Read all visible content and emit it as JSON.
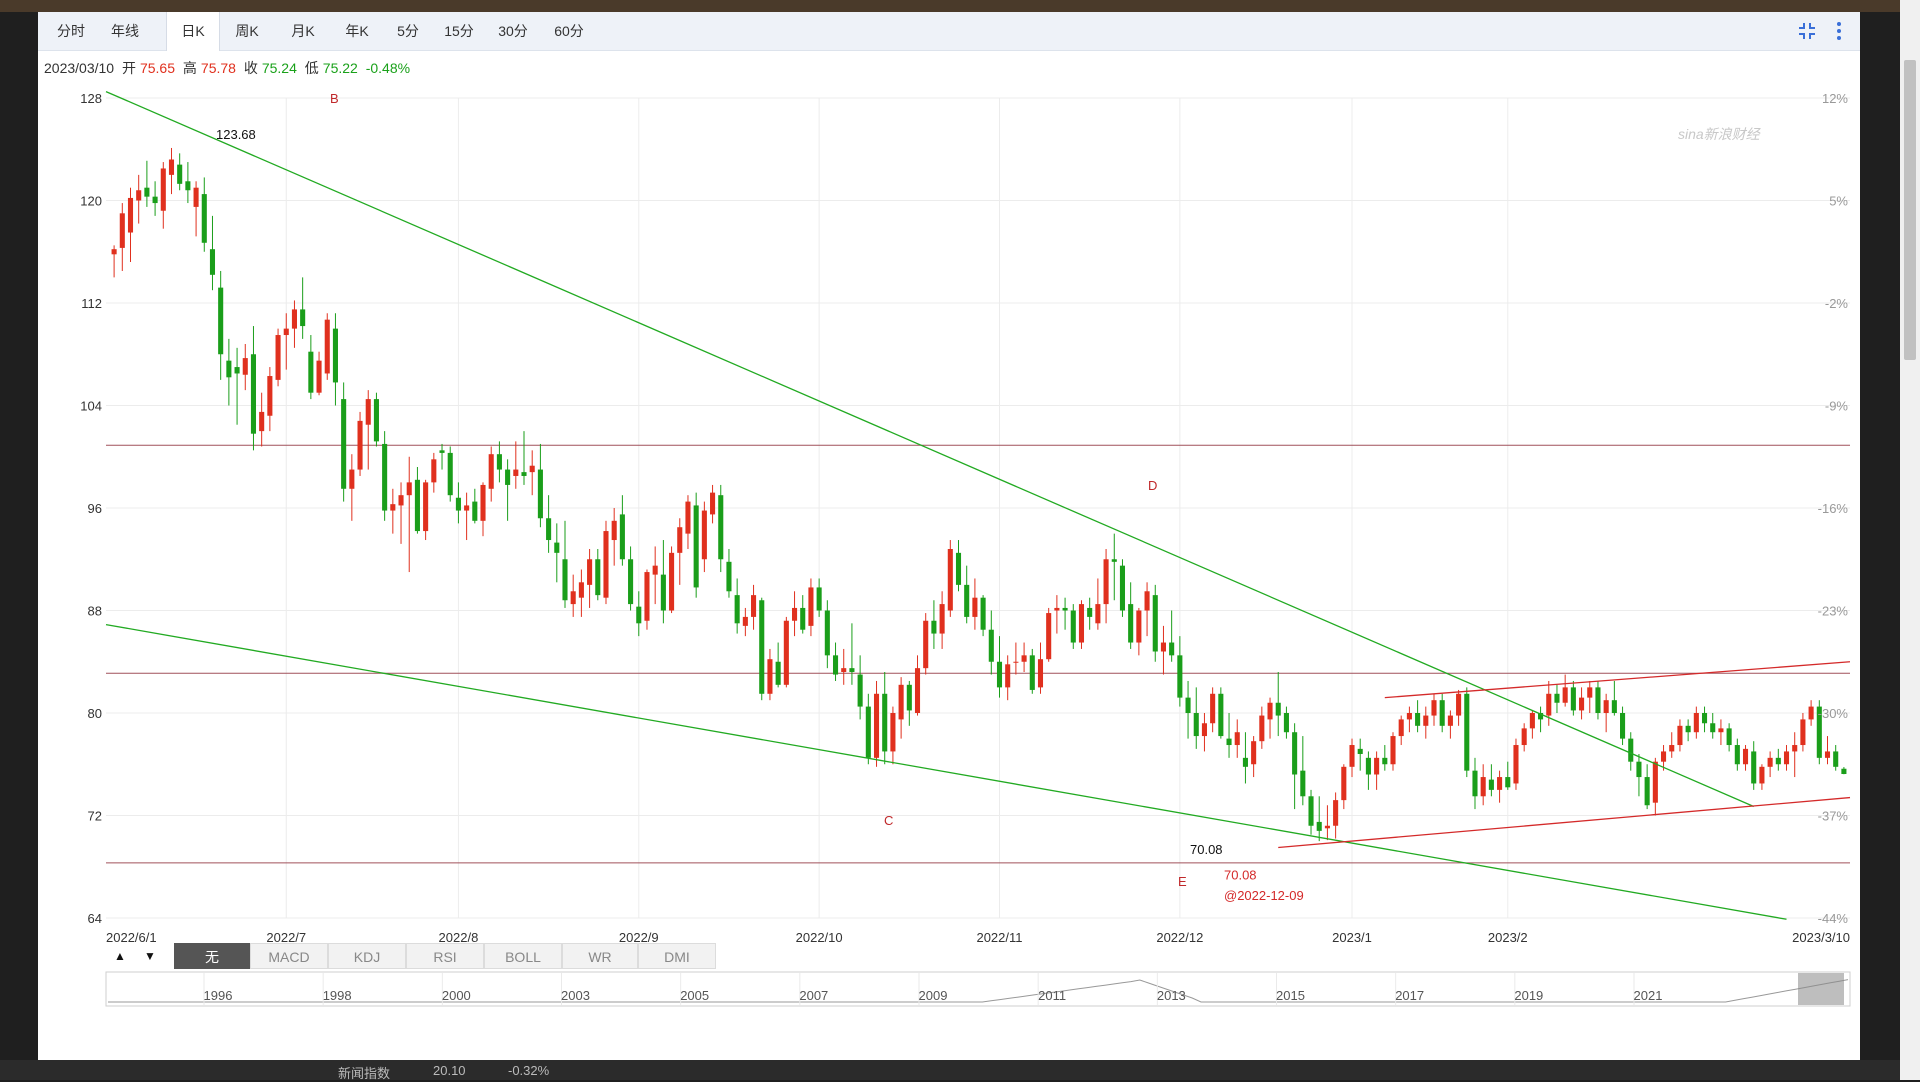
{
  "toolbar": {
    "tabs": [
      "分时",
      "年线",
      "日K",
      "周K",
      "月K",
      "年K",
      "5分",
      "15分",
      "30分",
      "60分"
    ],
    "active_tab": "日K",
    "icons": [
      "collapse-icon",
      "more-vertical-icon"
    ]
  },
  "quote": {
    "date": "2023/03/10",
    "open_label": "开",
    "open": "75.65",
    "high_label": "高",
    "high": "75.78",
    "close_label": "收",
    "close": "75.24",
    "low_label": "低",
    "low": "75.22",
    "change": "-0.48%"
  },
  "indicators": {
    "tabs": [
      "无",
      "MACD",
      "KDJ",
      "RSI",
      "BOLL",
      "WR",
      "DMI"
    ],
    "active": "无",
    "up_arrow": "▲",
    "down_arrow": "▼"
  },
  "overview": {
    "years": [
      "1996",
      "1998",
      "2000",
      "2003",
      "2005",
      "2007",
      "2009",
      "2011",
      "2013",
      "2015",
      "2017",
      "2019",
      "2021"
    ]
  },
  "background_text": {
    "bottom_items": [
      "新闻指数",
      "20.10",
      "-0.32%"
    ]
  },
  "chart_data": {
    "type": "candlestick",
    "xlabels": [
      "2022/6/1",
      "2022/7",
      "2022/8",
      "2022/9",
      "2022/10",
      "2022/11",
      "2022/12",
      "2023/1",
      "2023/2",
      "2023/3/10"
    ],
    "y_left_ticks": [
      128,
      120,
      112,
      104,
      96,
      88,
      80,
      72,
      64
    ],
    "ylim": [
      64,
      128
    ],
    "y_right_ticks": [
      "12%",
      "5%",
      "-2%",
      "-9%",
      "-16%",
      "-23%",
      "-30%",
      "-37%",
      "-44%"
    ],
    "annotations": [
      {
        "text": "B"
      },
      {
        "text": "C"
      },
      {
        "text": "D"
      },
      {
        "text": "E"
      },
      {
        "text": "123.68"
      },
      {
        "text": "70.08"
      },
      {
        "text": "70.08"
      },
      {
        "text": "@2022-12-09"
      }
    ],
    "horizontal_levels": [
      100.9,
      83.1,
      68.3
    ],
    "trendlines": [
      {
        "color": "#22aa22",
        "from": [
          "2022/6/1",
          128.5
        ],
        "to": [
          "2023/2/22",
          72.7
        ]
      },
      {
        "color": "#22aa22",
        "from": [
          "2022/6/1",
          86.9
        ],
        "to": [
          "2023/2/28",
          63.9
        ]
      },
      {
        "color": "#d42a2a",
        "from": [
          "2022/12/28",
          81.2
        ],
        "to": [
          "2023/3/10",
          84.0
        ]
      },
      {
        "color": "#d42a2a",
        "from": [
          "2022/12/14",
          69.5
        ],
        "to": [
          "2023/3/10",
          73.4
        ]
      }
    ],
    "watermark": "sina新浪财经",
    "candles": [
      [
        115.8,
        116.5,
        114.0,
        116.2
      ],
      [
        116.3,
        119.8,
        114.5,
        119.0
      ],
      [
        117.5,
        121.0,
        115.2,
        120.2
      ],
      [
        120.0,
        122.0,
        118.2,
        120.8
      ],
      [
        121.0,
        123.1,
        119.5,
        120.3
      ],
      [
        120.3,
        121.5,
        118.8,
        119.8
      ],
      [
        119.2,
        123.0,
        117.8,
        122.5
      ],
      [
        122.0,
        124.1,
        120.5,
        123.2
      ],
      [
        122.8,
        123.68,
        120.8,
        121.3
      ],
      [
        121.5,
        123.0,
        119.8,
        120.8
      ],
      [
        119.5,
        121.5,
        117.2,
        121.0
      ],
      [
        120.5,
        121.8,
        116.0,
        116.7
      ],
      [
        116.2,
        118.8,
        113.0,
        114.2
      ],
      [
        113.2,
        114.5,
        106.0,
        108.0
      ],
      [
        107.5,
        109.2,
        104.0,
        106.2
      ],
      [
        107.0,
        108.5,
        102.5,
        106.5
      ],
      [
        106.4,
        108.8,
        105.2,
        107.7
      ],
      [
        108.0,
        110.2,
        100.5,
        101.8
      ],
      [
        102.0,
        105.0,
        100.8,
        103.5
      ],
      [
        103.2,
        107.0,
        102.0,
        106.3
      ],
      [
        106.0,
        110.0,
        105.5,
        109.5
      ],
      [
        109.5,
        111.2,
        106.8,
        110.0
      ],
      [
        110.0,
        112.2,
        108.5,
        111.5
      ],
      [
        111.5,
        114.0,
        109.2,
        110.2
      ],
      [
        108.2,
        109.5,
        104.5,
        105.0
      ],
      [
        105.0,
        108.2,
        104.8,
        107.5
      ],
      [
        106.5,
        111.2,
        106.0,
        110.7
      ],
      [
        110.0,
        111.2,
        104.0,
        105.8
      ],
      [
        104.5,
        105.8,
        96.5,
        97.5
      ],
      [
        97.5,
        100.2,
        95.0,
        99.0
      ],
      [
        99.0,
        103.5,
        98.5,
        102.8
      ],
      [
        102.5,
        105.2,
        99.0,
        104.5
      ],
      [
        104.5,
        105.0,
        100.8,
        101.2
      ],
      [
        101.0,
        102.0,
        95.0,
        95.8
      ],
      [
        95.8,
        97.5,
        94.0,
        96.3
      ],
      [
        96.2,
        98.0,
        93.2,
        97.0
      ],
      [
        97.0,
        100.0,
        91.0,
        98.0
      ],
      [
        98.2,
        99.2,
        94.0,
        94.2
      ],
      [
        94.2,
        98.2,
        93.5,
        98.0
      ],
      [
        98.0,
        100.3,
        97.2,
        99.8
      ],
      [
        100.5,
        101.0,
        99.0,
        100.3
      ],
      [
        100.3,
        100.8,
        96.5,
        97.0
      ],
      [
        96.8,
        98.0,
        94.8,
        95.8
      ],
      [
        95.8,
        97.2,
        93.5,
        96.2
      ],
      [
        96.5,
        97.5,
        94.8,
        95.0
      ],
      [
        95.0,
        98.0,
        93.8,
        97.8
      ],
      [
        97.5,
        100.8,
        96.5,
        100.2
      ],
      [
        100.2,
        101.2,
        98.0,
        99.0
      ],
      [
        99.0,
        99.8,
        95.0,
        97.8
      ],
      [
        98.5,
        101.2,
        97.5,
        99.0
      ],
      [
        98.8,
        102.0,
        97.8,
        98.5
      ],
      [
        98.8,
        100.5,
        97.0,
        99.3
      ],
      [
        99.0,
        101.0,
        94.5,
        95.2
      ],
      [
        95.2,
        97.0,
        92.5,
        93.5
      ],
      [
        93.3,
        94.8,
        90.2,
        92.5
      ],
      [
        92.0,
        95.0,
        88.2,
        88.8
      ],
      [
        88.5,
        90.8,
        87.5,
        89.5
      ],
      [
        89.0,
        91.2,
        87.5,
        90.2
      ],
      [
        90.0,
        92.8,
        88.2,
        92.0
      ],
      [
        92.0,
        92.8,
        88.8,
        89.2
      ],
      [
        89.0,
        95.0,
        88.5,
        94.2
      ],
      [
        93.5,
        96.0,
        91.5,
        95.0
      ],
      [
        95.5,
        97.0,
        91.5,
        92.0
      ],
      [
        92.0,
        93.0,
        88.0,
        88.5
      ],
      [
        88.3,
        89.5,
        86.0,
        87.0
      ],
      [
        87.2,
        91.2,
        86.5,
        91.0
      ],
      [
        90.8,
        93.0,
        88.5,
        91.5
      ],
      [
        90.8,
        93.5,
        87.0,
        88.0
      ],
      [
        88.0,
        93.0,
        87.8,
        92.5
      ],
      [
        92.5,
        95.2,
        90.0,
        94.5
      ],
      [
        94.0,
        97.0,
        92.8,
        96.5
      ],
      [
        96.2,
        97.2,
        89.0,
        89.8
      ],
      [
        92.0,
        96.5,
        91.0,
        95.8
      ],
      [
        95.5,
        97.8,
        94.8,
        97.2
      ],
      [
        97.0,
        97.8,
        91.0,
        92.0
      ],
      [
        91.8,
        92.8,
        89.0,
        89.5
      ],
      [
        89.2,
        90.5,
        86.2,
        87.0
      ],
      [
        86.8,
        88.2,
        86.0,
        87.5
      ],
      [
        87.5,
        90.0,
        86.5,
        89.2
      ],
      [
        88.8,
        89.0,
        81.0,
        81.5
      ],
      [
        81.5,
        85.0,
        81.0,
        84.2
      ],
      [
        84.0,
        85.5,
        82.0,
        82.2
      ],
      [
        82.2,
        87.5,
        82.0,
        87.2
      ],
      [
        87.2,
        89.5,
        86.0,
        88.2
      ],
      [
        88.2,
        89.2,
        86.2,
        86.5
      ],
      [
        86.8,
        90.5,
        86.0,
        89.8
      ],
      [
        89.8,
        90.5,
        87.5,
        88.0
      ],
      [
        88.0,
        88.8,
        83.5,
        84.5
      ],
      [
        84.5,
        85.5,
        82.5,
        83.0
      ],
      [
        83.2,
        85.0,
        82.2,
        83.5
      ],
      [
        83.5,
        87.0,
        82.2,
        83.2
      ],
      [
        83.0,
        84.5,
        79.5,
        80.5
      ],
      [
        80.5,
        81.5,
        76.0,
        76.5
      ],
      [
        76.5,
        82.5,
        75.8,
        81.5
      ],
      [
        81.5,
        83.2,
        76.0,
        77.0
      ],
      [
        77.0,
        80.5,
        76.0,
        80.0
      ],
      [
        79.5,
        82.8,
        78.0,
        82.2
      ],
      [
        82.2,
        82.5,
        79.0,
        80.2
      ],
      [
        80.0,
        84.5,
        79.8,
        83.5
      ],
      [
        83.5,
        87.8,
        83.0,
        87.2
      ],
      [
        87.2,
        88.8,
        85.0,
        86.2
      ],
      [
        86.2,
        89.5,
        85.0,
        88.5
      ],
      [
        88.0,
        93.5,
        87.5,
        92.8
      ],
      [
        92.5,
        93.5,
        89.5,
        90.0
      ],
      [
        90.0,
        91.5,
        87.0,
        87.5
      ],
      [
        87.5,
        90.5,
        86.5,
        89.0
      ],
      [
        89.0,
        89.2,
        86.0,
        86.5
      ],
      [
        86.5,
        88.0,
        83.0,
        84.0
      ],
      [
        84.0,
        86.0,
        81.2,
        82.0
      ],
      [
        82.0,
        84.5,
        81.0,
        83.8
      ],
      [
        84.0,
        85.5,
        83.0,
        84.0
      ],
      [
        84.0,
        85.5,
        83.2,
        84.5
      ],
      [
        84.5,
        85.0,
        81.5,
        81.8
      ],
      [
        82.0,
        85.5,
        81.5,
        84.2
      ],
      [
        84.2,
        88.2,
        84.0,
        87.8
      ],
      [
        88.0,
        89.2,
        86.2,
        88.2
      ],
      [
        88.2,
        89.0,
        86.5,
        88.0
      ],
      [
        88.0,
        88.5,
        85.0,
        85.5
      ],
      [
        85.5,
        88.8,
        85.0,
        88.5
      ],
      [
        88.2,
        89.0,
        86.5,
        87.5
      ],
      [
        87.0,
        90.5,
        86.5,
        88.5
      ],
      [
        88.5,
        92.8,
        87.0,
        92.0
      ],
      [
        92.0,
        94.0,
        88.8,
        91.8
      ],
      [
        91.5,
        92.0,
        87.5,
        88.0
      ],
      [
        88.5,
        90.2,
        85.0,
        85.5
      ],
      [
        85.5,
        88.2,
        84.5,
        88.0
      ],
      [
        88.0,
        90.2,
        86.0,
        89.5
      ],
      [
        89.2,
        90.0,
        84.0,
        84.8
      ],
      [
        84.8,
        86.8,
        83.0,
        85.5
      ],
      [
        85.5,
        88.0,
        84.0,
        84.5
      ],
      [
        84.5,
        86.0,
        80.5,
        81.2
      ],
      [
        81.2,
        82.5,
        78.0,
        80.0
      ],
      [
        80.0,
        82.0,
        77.2,
        78.2
      ],
      [
        78.2,
        80.0,
        77.0,
        79.2
      ],
      [
        79.2,
        82.0,
        78.5,
        81.5
      ],
      [
        81.5,
        82.0,
        78.0,
        78.2
      ],
      [
        78.0,
        80.0,
        76.5,
        77.5
      ],
      [
        77.5,
        79.5,
        76.5,
        78.5
      ],
      [
        76.5,
        78.5,
        74.5,
        75.8
      ],
      [
        76.0,
        78.2,
        75.0,
        77.8
      ],
      [
        77.8,
        80.5,
        77.2,
        79.8
      ],
      [
        79.5,
        81.2,
        78.0,
        80.8
      ],
      [
        80.8,
        83.2,
        78.2,
        79.8
      ],
      [
        80.0,
        80.5,
        78.0,
        78.5
      ],
      [
        78.5,
        79.2,
        72.5,
        75.2
      ],
      [
        75.5,
        78.2,
        72.8,
        73.5
      ],
      [
        73.5,
        74.0,
        70.5,
        71.2
      ],
      [
        71.5,
        73.5,
        70.0,
        70.8
      ],
      [
        71.0,
        72.8,
        70.08,
        71.2
      ],
      [
        71.2,
        73.8,
        70.2,
        73.2
      ],
      [
        73.2,
        76.0,
        72.5,
        75.8
      ],
      [
        75.8,
        78.0,
        75.0,
        77.5
      ],
      [
        77.2,
        78.0,
        75.5,
        76.8
      ],
      [
        76.5,
        77.0,
        74.0,
        75.2
      ],
      [
        75.2,
        77.0,
        74.0,
        76.5
      ],
      [
        76.5,
        77.5,
        75.5,
        76.0
      ],
      [
        76.0,
        78.5,
        75.5,
        78.2
      ],
      [
        78.2,
        79.8,
        77.5,
        79.5
      ],
      [
        79.5,
        80.5,
        78.5,
        80.0
      ],
      [
        80.0,
        81.0,
        78.5,
        79.0
      ],
      [
        79.0,
        80.5,
        78.0,
        79.8
      ],
      [
        79.8,
        81.5,
        79.0,
        81.0
      ],
      [
        81.0,
        81.5,
        78.5,
        79.0
      ],
      [
        79.0,
        80.2,
        78.0,
        79.8
      ],
      [
        79.8,
        81.8,
        79.0,
        81.5
      ],
      [
        81.5,
        82.0,
        75.0,
        75.5
      ],
      [
        75.5,
        76.5,
        72.5,
        73.5
      ],
      [
        73.5,
        76.0,
        72.8,
        75.0
      ],
      [
        74.8,
        76.0,
        73.5,
        74.0
      ],
      [
        74.0,
        75.5,
        73.0,
        75.0
      ],
      [
        75.0,
        76.2,
        74.0,
        74.2
      ],
      [
        74.5,
        78.0,
        74.0,
        77.5
      ],
      [
        77.5,
        79.2,
        77.0,
        78.8
      ],
      [
        78.8,
        80.2,
        78.0,
        80.0
      ],
      [
        80.0,
        80.5,
        78.5,
        79.5
      ],
      [
        79.8,
        82.5,
        79.0,
        81.5
      ],
      [
        81.5,
        82.2,
        80.0,
        80.8
      ],
      [
        80.8,
        83.0,
        80.5,
        82.0
      ],
      [
        82.0,
        82.5,
        79.8,
        80.2
      ],
      [
        80.2,
        82.0,
        79.5,
        81.2
      ],
      [
        81.2,
        82.5,
        80.0,
        82.0
      ],
      [
        82.0,
        82.5,
        79.5,
        80.0
      ],
      [
        80.0,
        81.5,
        78.5,
        81.0
      ],
      [
        81.0,
        82.5,
        79.8,
        80.0
      ],
      [
        80.0,
        80.5,
        77.5,
        78.0
      ],
      [
        78.0,
        78.5,
        75.5,
        76.2
      ],
      [
        76.2,
        76.8,
        73.5,
        75.0
      ],
      [
        75.0,
        76.0,
        72.5,
        72.8
      ],
      [
        73.0,
        76.5,
        72.0,
        76.2
      ],
      [
        76.2,
        77.5,
        75.5,
        77.0
      ],
      [
        77.0,
        78.5,
        76.5,
        77.5
      ],
      [
        77.5,
        79.5,
        77.0,
        79.0
      ],
      [
        79.0,
        79.5,
        77.8,
        78.5
      ],
      [
        78.5,
        80.5,
        78.0,
        80.0
      ],
      [
        80.0,
        80.5,
        78.5,
        79.2
      ],
      [
        79.2,
        80.0,
        78.0,
        78.5
      ],
      [
        78.5,
        79.5,
        77.5,
        78.8
      ],
      [
        78.8,
        79.2,
        77.0,
        77.5
      ],
      [
        77.5,
        78.0,
        75.5,
        76.0
      ],
      [
        76.0,
        77.5,
        75.5,
        77.2
      ],
      [
        77.0,
        77.8,
        74.0,
        74.5
      ],
      [
        74.5,
        76.0,
        74.0,
        75.8
      ],
      [
        75.8,
        77.0,
        75.0,
        76.5
      ],
      [
        76.5,
        77.2,
        75.5,
        76.0
      ],
      [
        76.0,
        77.5,
        75.5,
        77.0
      ],
      [
        77.0,
        78.5,
        75.0,
        77.5
      ],
      [
        77.5,
        80.0,
        77.0,
        79.5
      ],
      [
        79.5,
        81.0,
        79.0,
        80.5
      ],
      [
        80.5,
        81.0,
        76.0,
        76.5
      ],
      [
        76.5,
        78.2,
        76.0,
        77.0
      ],
      [
        77.0,
        77.5,
        75.5,
        75.8
      ],
      [
        75.65,
        75.78,
        75.22,
        75.24
      ]
    ]
  }
}
